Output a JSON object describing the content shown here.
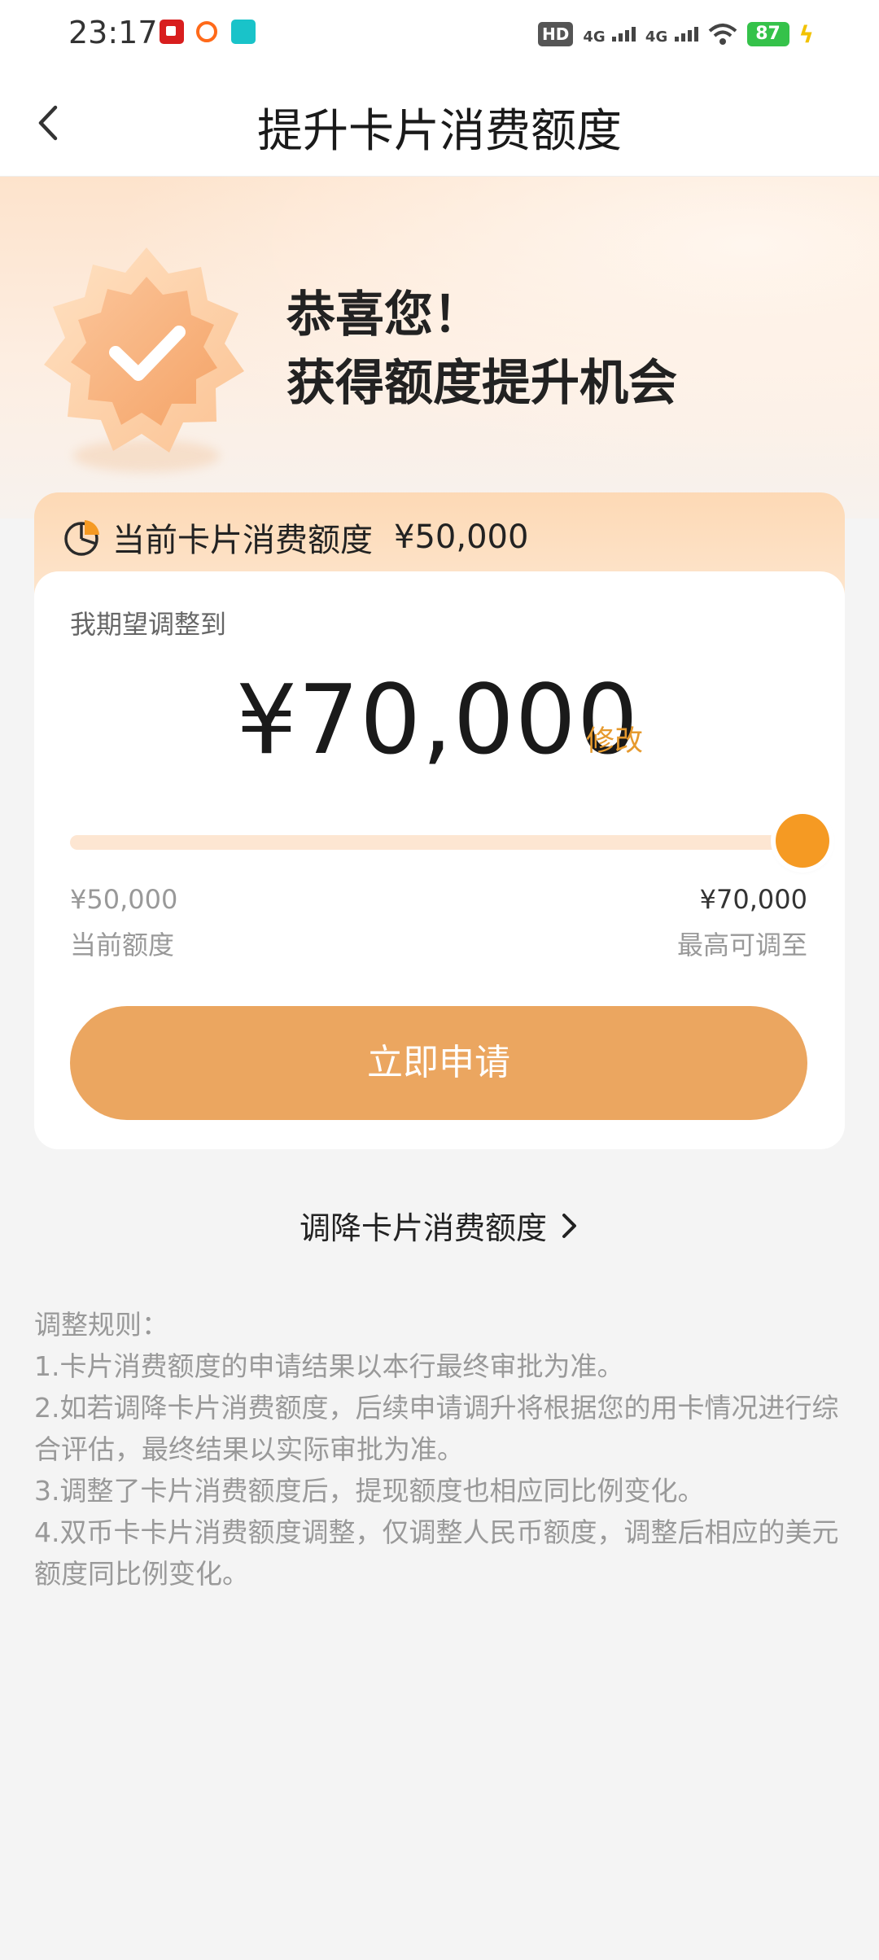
{
  "status_bar": {
    "time": "23:17",
    "hd_label": "HD",
    "net1": "4G",
    "net2": "4G",
    "battery": "87"
  },
  "nav": {
    "title": "提升卡片消费额度"
  },
  "hero": {
    "line1": "恭喜您！",
    "line2": "获得额度提升机会"
  },
  "current": {
    "label": "当前卡片消费额度",
    "amount": "¥50,000"
  },
  "adjust": {
    "expect_label": "我期望调整到",
    "amount": "¥70,000",
    "modify_label": "修改",
    "slider": {
      "min_value": "¥50,000",
      "min_label": "当前额度",
      "max_value": "¥70,000",
      "max_label": "最高可调至",
      "position_fraction": 1.0
    },
    "apply_label": "立即申请"
  },
  "lower_link": "调降卡片消费额度",
  "rules": {
    "title": "调整规则：",
    "items": [
      "1.卡片消费额度的申请结果以本行最终审批为准。",
      "2.如若调降卡片消费额度，后续申请调升将根据您的用卡情况进行综合评估，最终结果以实际审批为准。",
      "3.调整了卡片消费额度后，提现额度也相应同比例变化。",
      "4.双币卡卡片消费额度调整，仅调整人民币额度，调整后相应的美元额度同比例变化。"
    ]
  },
  "colors": {
    "accent": "#f59a23",
    "button": "#eba660",
    "modify": "#e69a2e"
  }
}
